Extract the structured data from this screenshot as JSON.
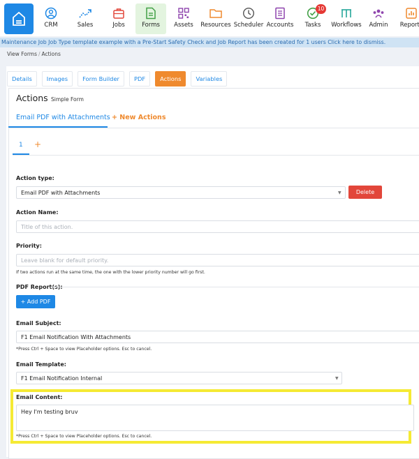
{
  "nav": {
    "items": [
      {
        "label": "CRM",
        "icon": "user-circle-icon"
      },
      {
        "label": "Sales",
        "icon": "trend-icon"
      },
      {
        "label": "Jobs",
        "icon": "briefcase-icon"
      },
      {
        "label": "Forms",
        "icon": "document-icon"
      },
      {
        "label": "Assets",
        "icon": "qr-code-icon"
      },
      {
        "label": "Resources",
        "icon": "folder-icon"
      },
      {
        "label": "Scheduler",
        "icon": "clock-icon"
      },
      {
        "label": "Accounts",
        "icon": "ledger-icon"
      },
      {
        "label": "Tasks",
        "icon": "check-circle-icon",
        "badge": "10"
      },
      {
        "label": "Workflows",
        "icon": "workflow-icon"
      },
      {
        "label": "Admin",
        "icon": "users-icon"
      },
      {
        "label": "Reports",
        "icon": "chart-icon"
      }
    ],
    "active": "Forms",
    "colors": {
      "brand": "#1e88e5",
      "orange": "#ef8a2e",
      "green": "#43a047",
      "purple": "#8e44ad"
    }
  },
  "banner": "Maintenance Job Job Type template example with a Pre-Start Safety Check and Job Report has been created for 1 users Click here to dismiss.",
  "breadcrumb": {
    "items": [
      "View Forms",
      "Actions"
    ]
  },
  "tabs": [
    "Details",
    "Images",
    "Form Builder",
    "PDF",
    "Actions",
    "Variables"
  ],
  "active_tab": "Actions",
  "actions": {
    "title": "Actions",
    "subtitle": "Simple Form",
    "action_tabs": [
      "Email PDF with Attachments",
      "+ New Actions"
    ],
    "steps": [
      "1",
      "+"
    ]
  },
  "form": {
    "action_type": {
      "label": "Action type:",
      "value": "Email PDF with Attachments"
    },
    "delete_label": "Delete",
    "action_name": {
      "label": "Action Name:",
      "placeholder": "Title of this action."
    },
    "priority": {
      "label": "Priority:",
      "placeholder": "Leave blank for default priority.",
      "help": "If two actions run at the same time, the one with the lower priority number will go first."
    },
    "pdf_reports": {
      "label": "PDF Report(s):",
      "add_label": "+ Add PDF"
    },
    "email_subject": {
      "label": "Email Subject:",
      "value": "F1 Email Notification With Attachments",
      "help": "*Press Ctrl + Space to view Placeholder options. Esc to cancel."
    },
    "email_template": {
      "label": "Email Template:",
      "value": "F1 Email Notification Internal"
    },
    "email_content": {
      "label": "Email Content:",
      "value": "Hey I'm testing bruv",
      "help": "*Press Ctrl + Space to view Placeholder options. Esc to cancel."
    }
  }
}
